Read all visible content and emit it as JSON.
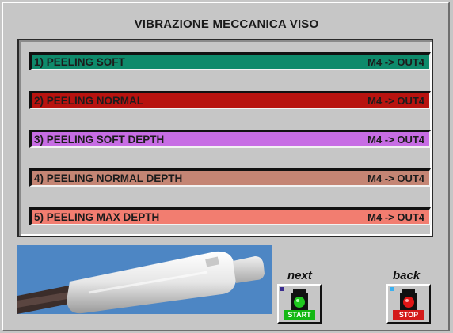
{
  "window": {
    "title": "VIBRAZIONE MECCANICA VISO"
  },
  "programs": [
    {
      "label": "1)  PEELING  SOFT",
      "output": "M4 -> OUT4",
      "color": "#0e8a6b"
    },
    {
      "label": "2)  PEELING  NORMAL",
      "output": "M4 -> OUT4",
      "color": "#b8130f"
    },
    {
      "label": "3)  PEELING SOFT DEPTH",
      "output": "M4 -> OUT4",
      "color": "#c76de4"
    },
    {
      "label": "4)  PEELING  NORMAL DEPTH",
      "output": "M4 -> OUT4",
      "color": "#c48574"
    },
    {
      "label": "5)  PEELING  MAX DEPTH",
      "output": "M4 -> OUT4",
      "color": "#f27d70"
    }
  ],
  "controls": {
    "next_label": "next",
    "back_label": "back",
    "start": {
      "caption": "START",
      "light_color": "#1fc81f",
      "caption_bg": "#14b814",
      "corner_color": "#3a2c8e"
    },
    "stop": {
      "caption": "STOP",
      "light_color": "#e01515",
      "caption_bg": "#d41a1a",
      "corner_color": "#3ab0f0"
    }
  },
  "device_image": {
    "icon": "vibration-handpiece-image",
    "background": "#4d86c4"
  }
}
